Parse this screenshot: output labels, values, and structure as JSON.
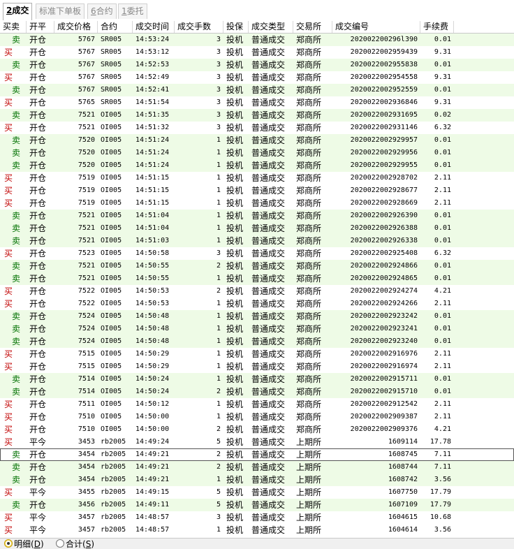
{
  "tabs": [
    {
      "key": "2",
      "label": "成交"
    },
    {
      "key": "",
      "label": "标准下单板"
    },
    {
      "key": "6",
      "label": "合约"
    },
    {
      "key": "1",
      "label": "委托"
    }
  ],
  "columns": [
    "买卖",
    "开平",
    "成交价格",
    "合约",
    "成交时间",
    "成交手数",
    "投保",
    "成交类型",
    "交易所",
    "成交编号",
    "手续费"
  ],
  "rows": [
    [
      "卖",
      "开仓",
      "5767",
      "SR005",
      "14:53:24",
      "3",
      "投机",
      "普通成交",
      "郑商所",
      "202002200296l390",
      "0.01"
    ],
    [
      "买",
      "开仓",
      "5767",
      "SR005",
      "14:53:12",
      "3",
      "投机",
      "普通成交",
      "郑商所",
      "2020022002959439",
      "9.31"
    ],
    [
      "卖",
      "开仓",
      "5767",
      "SR005",
      "14:52:53",
      "3",
      "投机",
      "普通成交",
      "郑商所",
      "2020022002955838",
      "0.01"
    ],
    [
      "买",
      "开仓",
      "5767",
      "SR005",
      "14:52:49",
      "3",
      "投机",
      "普通成交",
      "郑商所",
      "2020022002954558",
      "9.31"
    ],
    [
      "卖",
      "开仓",
      "5767",
      "SR005",
      "14:52:41",
      "3",
      "投机",
      "普通成交",
      "郑商所",
      "2020022002952559",
      "0.01"
    ],
    [
      "买",
      "开仓",
      "5765",
      "SR005",
      "14:51:54",
      "3",
      "投机",
      "普通成交",
      "郑商所",
      "2020022002936846",
      "9.31"
    ],
    [
      "卖",
      "开仓",
      "7521",
      "OI005",
      "14:51:35",
      "3",
      "投机",
      "普通成交",
      "郑商所",
      "2020022002931695",
      "0.02"
    ],
    [
      "买",
      "开仓",
      "7521",
      "OI005",
      "14:51:32",
      "3",
      "投机",
      "普通成交",
      "郑商所",
      "2020022002931146",
      "6.32"
    ],
    [
      "卖",
      "开仓",
      "7520",
      "OI005",
      "14:51:24",
      "1",
      "投机",
      "普通成交",
      "郑商所",
      "2020022002929957",
      "0.01"
    ],
    [
      "卖",
      "开仓",
      "7520",
      "OI005",
      "14:51:24",
      "1",
      "投机",
      "普通成交",
      "郑商所",
      "2020022002929956",
      "0.01"
    ],
    [
      "卖",
      "开仓",
      "7520",
      "OI005",
      "14:51:24",
      "1",
      "投机",
      "普通成交",
      "郑商所",
      "2020022002929955",
      "0.01"
    ],
    [
      "买",
      "开仓",
      "7519",
      "OI005",
      "14:51:15",
      "1",
      "投机",
      "普通成交",
      "郑商所",
      "2020022002928702",
      "2.11"
    ],
    [
      "买",
      "开仓",
      "7519",
      "OI005",
      "14:51:15",
      "1",
      "投机",
      "普通成交",
      "郑商所",
      "2020022002928677",
      "2.11"
    ],
    [
      "买",
      "开仓",
      "7519",
      "OI005",
      "14:51:15",
      "1",
      "投机",
      "普通成交",
      "郑商所",
      "2020022002928669",
      "2.11"
    ],
    [
      "卖",
      "开仓",
      "7521",
      "OI005",
      "14:51:04",
      "1",
      "投机",
      "普通成交",
      "郑商所",
      "2020022002926390",
      "0.01"
    ],
    [
      "卖",
      "开仓",
      "7521",
      "OI005",
      "14:51:04",
      "1",
      "投机",
      "普通成交",
      "郑商所",
      "2020022002926388",
      "0.01"
    ],
    [
      "卖",
      "开仓",
      "7521",
      "OI005",
      "14:51:03",
      "1",
      "投机",
      "普通成交",
      "郑商所",
      "2020022002926338",
      "0.01"
    ],
    [
      "买",
      "开仓",
      "7523",
      "OI005",
      "14:50:58",
      "3",
      "投机",
      "普通成交",
      "郑商所",
      "2020022002925408",
      "6.32"
    ],
    [
      "卖",
      "开仓",
      "7521",
      "OI005",
      "14:50:55",
      "2",
      "投机",
      "普通成交",
      "郑商所",
      "2020022002924866",
      "0.01"
    ],
    [
      "卖",
      "开仓",
      "7521",
      "OI005",
      "14:50:55",
      "1",
      "投机",
      "普通成交",
      "郑商所",
      "2020022002924865",
      "0.01"
    ],
    [
      "买",
      "开仓",
      "7522",
      "OI005",
      "14:50:53",
      "2",
      "投机",
      "普通成交",
      "郑商所",
      "2020022002924274",
      "4.21"
    ],
    [
      "买",
      "开仓",
      "7522",
      "OI005",
      "14:50:53",
      "1",
      "投机",
      "普通成交",
      "郑商所",
      "2020022002924266",
      "2.11"
    ],
    [
      "卖",
      "开仓",
      "7524",
      "OI005",
      "14:50:48",
      "1",
      "投机",
      "普通成交",
      "郑商所",
      "2020022002923242",
      "0.01"
    ],
    [
      "卖",
      "开仓",
      "7524",
      "OI005",
      "14:50:48",
      "1",
      "投机",
      "普通成交",
      "郑商所",
      "2020022002923241",
      "0.01"
    ],
    [
      "卖",
      "开仓",
      "7524",
      "OI005",
      "14:50:48",
      "1",
      "投机",
      "普通成交",
      "郑商所",
      "2020022002923240",
      "0.01"
    ],
    [
      "买",
      "开仓",
      "7515",
      "OI005",
      "14:50:29",
      "1",
      "投机",
      "普通成交",
      "郑商所",
      "2020022002916976",
      "2.11"
    ],
    [
      "买",
      "开仓",
      "7515",
      "OI005",
      "14:50:29",
      "1",
      "投机",
      "普通成交",
      "郑商所",
      "2020022002916974",
      "2.11"
    ],
    [
      "卖",
      "开仓",
      "7514",
      "OI005",
      "14:50:24",
      "1",
      "投机",
      "普通成交",
      "郑商所",
      "2020022002915711",
      "0.01"
    ],
    [
      "卖",
      "开仓",
      "7514",
      "OI005",
      "14:50:24",
      "2",
      "投机",
      "普通成交",
      "郑商所",
      "2020022002915710",
      "0.01"
    ],
    [
      "买",
      "开仓",
      "7511",
      "OI005",
      "14:50:12",
      "1",
      "投机",
      "普通成交",
      "郑商所",
      "2020022002912542",
      "2.11"
    ],
    [
      "买",
      "开仓",
      "7510",
      "OI005",
      "14:50:00",
      "1",
      "投机",
      "普通成交",
      "郑商所",
      "2020022002909387",
      "2.11"
    ],
    [
      "买",
      "开仓",
      "7510",
      "OI005",
      "14:50:00",
      "2",
      "投机",
      "普通成交",
      "郑商所",
      "2020022002909376",
      "4.21"
    ],
    [
      "买",
      "平今",
      "3453",
      "rb2005",
      "14:49:24",
      "5",
      "投机",
      "普通成交",
      "上期所",
      "1609114",
      "17.78"
    ],
    [
      "卖",
      "开仓",
      "3454",
      "rb2005",
      "14:49:21",
      "2",
      "投机",
      "普通成交",
      "上期所",
      "1608745",
      "7.11"
    ],
    [
      "卖",
      "开仓",
      "3454",
      "rb2005",
      "14:49:21",
      "2",
      "投机",
      "普通成交",
      "上期所",
      "1608744",
      "7.11"
    ],
    [
      "卖",
      "开仓",
      "3454",
      "rb2005",
      "14:49:21",
      "1",
      "投机",
      "普通成交",
      "上期所",
      "1608742",
      "3.56"
    ],
    [
      "买",
      "平今",
      "3455",
      "rb2005",
      "14:49:15",
      "5",
      "投机",
      "普通成交",
      "上期所",
      "1607750",
      "17.79"
    ],
    [
      "卖",
      "开仓",
      "3456",
      "rb2005",
      "14:49:11",
      "5",
      "投机",
      "普通成交",
      "上期所",
      "1607109",
      "17.79"
    ],
    [
      "买",
      "平今",
      "3457",
      "rb2005",
      "14:48:57",
      "3",
      "投机",
      "普通成交",
      "上期所",
      "1604615",
      "10.68"
    ],
    [
      "买",
      "平今",
      "3457",
      "rb2005",
      "14:48:57",
      "1",
      "投机",
      "普通成交",
      "上期所",
      "1604614",
      "3.56"
    ]
  ],
  "selected_row": 33,
  "footer": {
    "detail_label": "明细",
    "detail_key": "D",
    "total_label": "合计",
    "total_key": "S"
  },
  "colors": {
    "buy": "#c00000",
    "sell": "#007000",
    "row_green": "#eefbe6"
  }
}
